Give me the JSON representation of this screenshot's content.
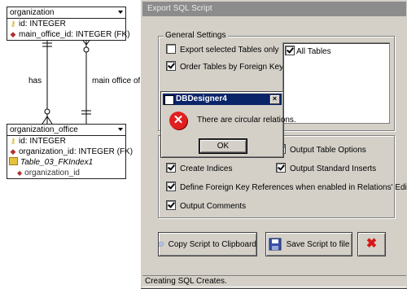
{
  "diagram": {
    "table1": {
      "name": "organization",
      "columns": [
        {
          "icon": "key-icon",
          "text": "id: INTEGER"
        },
        {
          "icon": "foreign-key-icon",
          "text": "main_office_id: INTEGER (FK)"
        }
      ]
    },
    "table2": {
      "name": "organization_office",
      "columns": [
        {
          "icon": "key-icon",
          "text": "id: INTEGER"
        },
        {
          "icon": "foreign-key-icon",
          "text": "organization_id: INTEGER (FK)"
        }
      ],
      "index_name": "Table_03_FKIndex1",
      "index_column": "organization_id"
    },
    "relation_left": "has",
    "relation_right": "main office of"
  },
  "window": {
    "title": "Export SQL Script",
    "general_settings_title": "General Settings",
    "options_top": [
      {
        "label": "Export selected Tables only",
        "checked": false
      },
      {
        "label": "Order Tables by Foreign Keys",
        "checked": true
      }
    ],
    "table_list": [
      {
        "label": "All Tables",
        "checked": true
      }
    ],
    "options_bottom": [
      {
        "label": "Create Indices",
        "checked": true
      },
      {
        "label": "Define Foreign Key References when enabled in Relations' Editors",
        "checked": true
      },
      {
        "label": "Output Comments",
        "checked": true
      }
    ],
    "options_right": [
      {
        "label": "Output Table Options",
        "checked": true
      },
      {
        "label": "Output Standard Inserts",
        "checked": true
      }
    ],
    "buttons": {
      "copy": "Copy Script to Clipboard",
      "save": "Save Script to file"
    },
    "status": "Creating SQL Creates."
  },
  "dialog": {
    "title": "DBDesigner4",
    "message": "There are circular relations.",
    "ok": "OK"
  },
  "colors": {
    "window_bg": "#d4d0c8",
    "dialog_title_bg": "#0a246a",
    "error_red": "#e02020"
  }
}
